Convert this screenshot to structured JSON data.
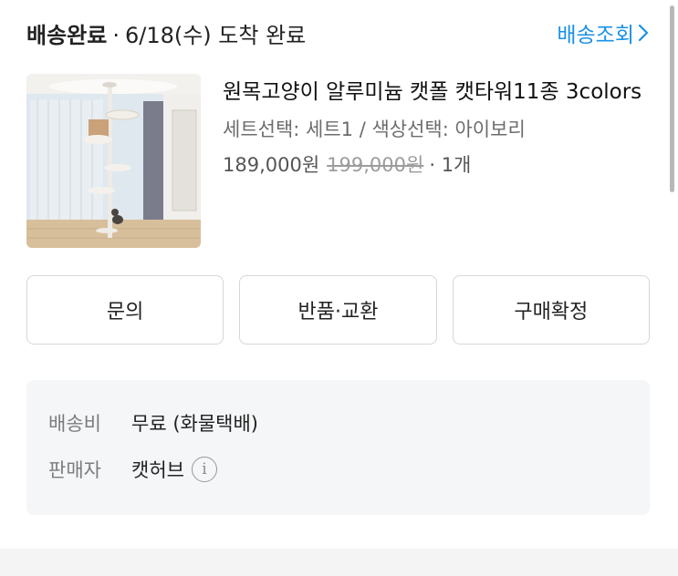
{
  "header": {
    "status": "배송완료",
    "separator": "·",
    "delivery": "6/18(수) 도착 완료",
    "track_label": "배송조회"
  },
  "product": {
    "name": "원목고양이 알루미늄 캣폴 캣타워11종 3colors",
    "options": "세트선택: 세트1 / 색상선택: 아이보리",
    "price": "189,000원",
    "original_price": "199,000원",
    "quantity": "· 1개",
    "image_icon": "product-photo"
  },
  "buttons": {
    "inquiry": "문의",
    "return": "반품·교환",
    "confirm": "구매확정"
  },
  "details": {
    "shipping_label": "배송비",
    "shipping_value": "무료 (화물택배)",
    "seller_label": "판매자",
    "seller_value": "캣허브",
    "info_icon_glyph": "i"
  },
  "colors": {
    "accent": "#1a91e6",
    "panel": "#f4f6f8"
  }
}
